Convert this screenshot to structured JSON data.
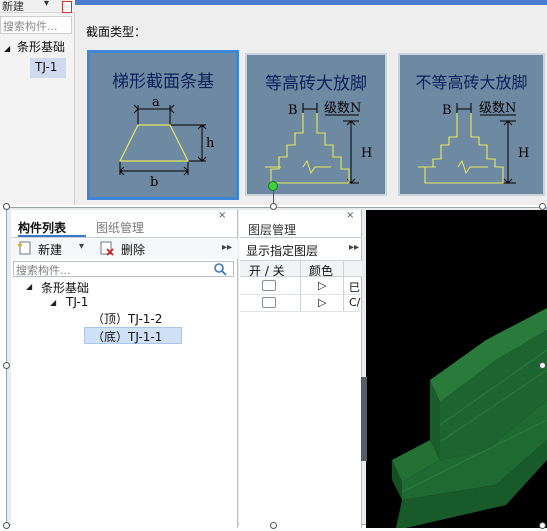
{
  "background_app": {
    "toolbar_new": "新建",
    "toolbar_caret": "▾",
    "search_placeholder": "搜索构件...",
    "tree": {
      "root": "条形基础",
      "child": "TJ-1"
    }
  },
  "section_panel": {
    "label": "截面类型：",
    "cards": [
      {
        "title": "梯形截面条基",
        "labels": [
          "a",
          "h",
          "b"
        ],
        "selected": true
      },
      {
        "title": "等高砖大放脚",
        "labels": [
          "B",
          "级数N",
          "H"
        ],
        "selected": false
      },
      {
        "title": "不等高砖大放脚",
        "labels": [
          "B",
          "级数N",
          "H"
        ],
        "selected": false
      }
    ]
  },
  "component_panel": {
    "tabs": {
      "component_list": "构件列表",
      "drawing_mgmt": "图纸管理"
    },
    "close": "×",
    "toolbar": {
      "new": "新建",
      "new_caret": "▾",
      "delete": "删除",
      "more": "▸▸"
    },
    "search_placeholder": "搜索构件...",
    "tree": {
      "root": "条形基础",
      "child": "TJ-1",
      "leaves": [
        "（顶）TJ-1-2",
        "（底）TJ-1-1"
      ]
    },
    "selected_leaf_index": 1
  },
  "layer_panel": {
    "title": "图层管理",
    "close": "×",
    "show_specified": "显示指定图层",
    "more": "▸▸",
    "columns": {
      "on_off": "开 / 关",
      "color": "颜色"
    },
    "rows": [
      {
        "color_arrow": "▷",
        "name": "巳"
      },
      {
        "color_arrow": "▷",
        "name": "C/"
      }
    ]
  },
  "colors": {
    "card_bg": "#6e8aa3",
    "card_selected_border": "#3d86d8",
    "diagram_line": "#e8e85a",
    "model_green": "#1f6a33",
    "selection_bg": "#cfe1f6"
  }
}
